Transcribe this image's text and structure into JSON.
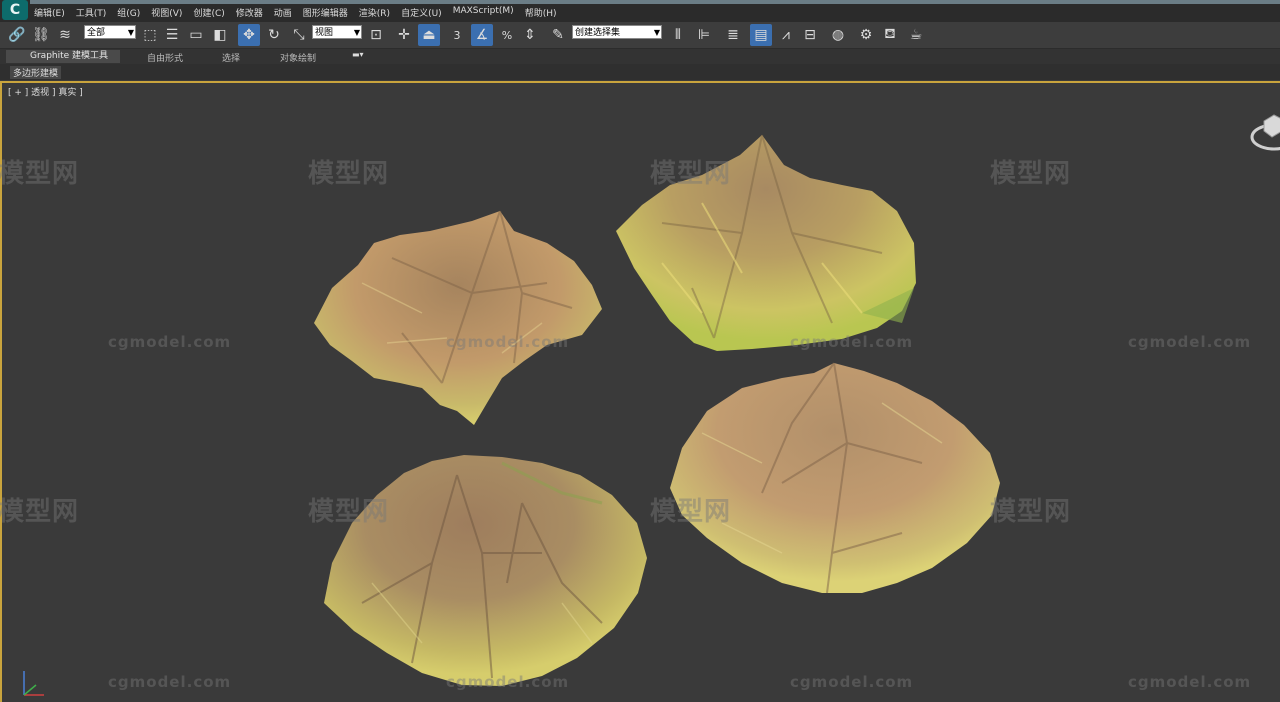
{
  "app": {
    "logo_text": "C"
  },
  "menu": [
    "编辑(E)",
    "工具(T)",
    "组(G)",
    "视图(V)",
    "创建(C)",
    "修改器",
    "动画",
    "图形编辑器",
    "渲染(R)",
    "自定义(U)",
    "MAXScript(M)",
    "帮助(H)"
  ],
  "toolbar": {
    "selection_filter": "全部",
    "reference_coord": "视图",
    "named_selection": "创建选择集",
    "snap_3": "3",
    "percent_snap": "%"
  },
  "ribbon": {
    "tabs": [
      "Graphite 建模工具",
      "自由形式",
      "选择",
      "对象绘制"
    ],
    "panel": "多边形建模"
  },
  "viewport": {
    "label": "[ + ] 透视 ] 真实 ]"
  },
  "watermarks": {
    "cn": "模型网",
    "en": "cgmodel.com"
  }
}
